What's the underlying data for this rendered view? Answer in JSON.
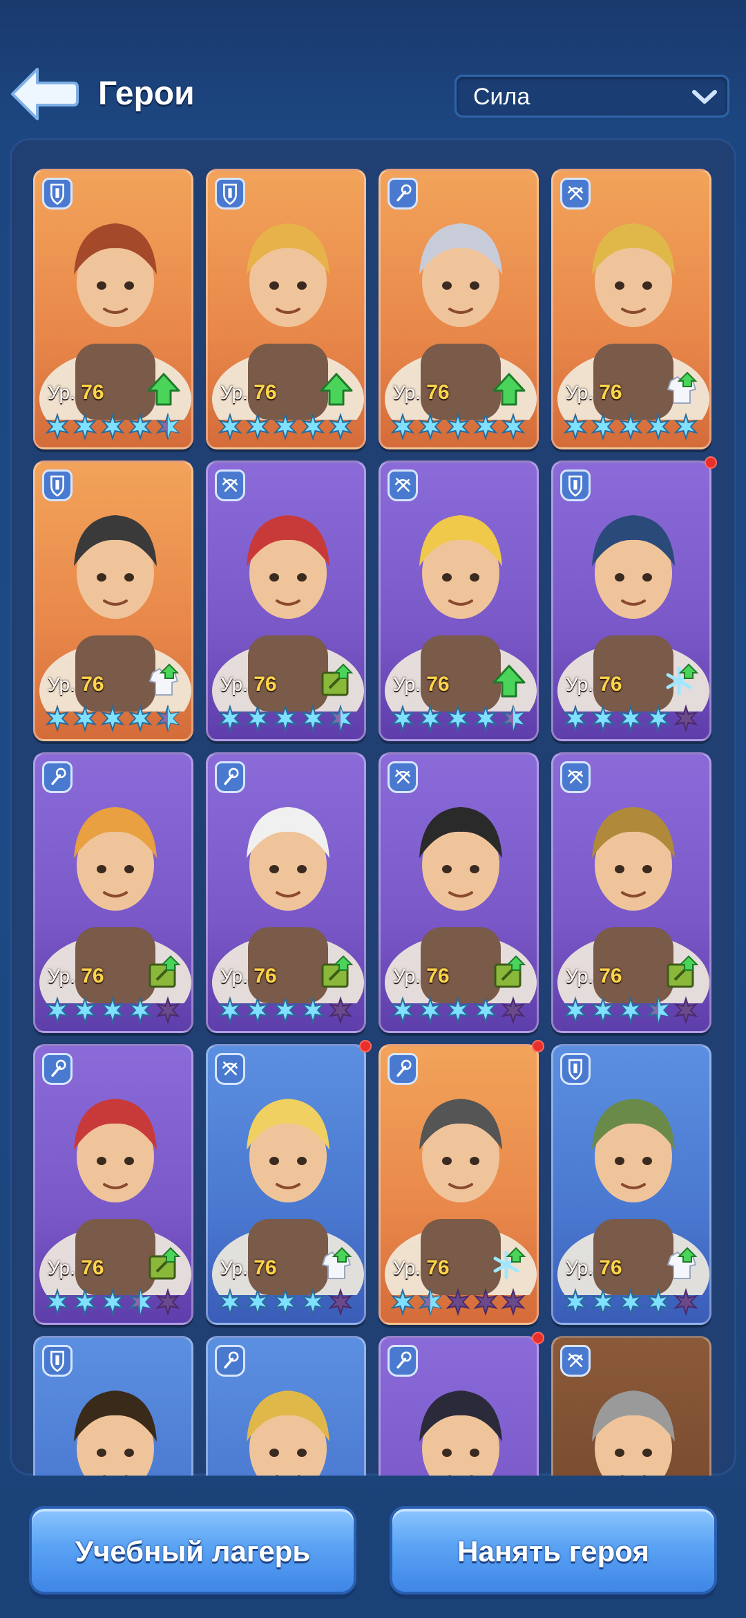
{
  "header": {
    "title": "Герои",
    "sort": {
      "selected": "Сила"
    }
  },
  "cards": [
    {
      "bg": "orange",
      "role": "shield",
      "level_prefix": "Ур.",
      "level": "76",
      "upgrade": "arrow",
      "stars": 4.5,
      "dot": false,
      "hair": "#a44a2a"
    },
    {
      "bg": "orange",
      "role": "shield",
      "level_prefix": "Ур.",
      "level": "76",
      "upgrade": "arrow",
      "stars": 5,
      "dot": false,
      "hair": "#e8b24a"
    },
    {
      "bg": "orange",
      "role": "wrench",
      "level_prefix": "Ур.",
      "level": "76",
      "upgrade": "arrow",
      "stars": 5,
      "dot": false,
      "hair": "#c8ccd8"
    },
    {
      "bg": "orange",
      "role": "crossbow",
      "level_prefix": "Ур.",
      "level": "76",
      "upgrade": "coat",
      "stars": 5,
      "dot": false,
      "hair": "#e0b84a"
    },
    {
      "bg": "orange",
      "role": "shield",
      "level_prefix": "Ур.",
      "level": "76",
      "upgrade": "coat",
      "stars": 4.5,
      "dot": false,
      "hair": "#3a3a3a"
    },
    {
      "bg": "purple",
      "role": "crossbow",
      "level_prefix": "Ур.",
      "level": "76",
      "upgrade": "book",
      "stars": 4.5,
      "dot": false,
      "hair": "#c83a3a"
    },
    {
      "bg": "purple",
      "role": "crossbow",
      "level_prefix": "Ур.",
      "level": "76",
      "upgrade": "arrow",
      "stars": 4.5,
      "dot": false,
      "hair": "#f0c84a"
    },
    {
      "bg": "purple",
      "role": "shield",
      "level_prefix": "Ур.",
      "level": "76",
      "upgrade": "snowflake",
      "stars": 4,
      "dot": true,
      "hair": "#2a4a7a"
    },
    {
      "bg": "purple",
      "role": "wrench",
      "level_prefix": "Ур.",
      "level": "76",
      "upgrade": "book",
      "stars": 4,
      "dot": false,
      "hair": "#e8a040"
    },
    {
      "bg": "purple",
      "role": "wrench",
      "level_prefix": "Ур.",
      "level": "76",
      "upgrade": "book",
      "stars": 4,
      "dot": false,
      "hair": "#f0f0f0"
    },
    {
      "bg": "purple",
      "role": "crossbow",
      "level_prefix": "Ур.",
      "level": "76",
      "upgrade": "book",
      "stars": 4,
      "dot": false,
      "hair": "#2a2a2a"
    },
    {
      "bg": "purple",
      "role": "crossbow",
      "level_prefix": "Ур.",
      "level": "76",
      "upgrade": "book",
      "stars": 3.5,
      "dot": false,
      "hair": "#b08a3a"
    },
    {
      "bg": "purple",
      "role": "wrench",
      "level_prefix": "Ур.",
      "level": "76",
      "upgrade": "book",
      "stars": 3.5,
      "dot": false,
      "hair": "#c83a3a"
    },
    {
      "bg": "blue",
      "role": "crossbow",
      "level_prefix": "Ур.",
      "level": "76",
      "upgrade": "coat",
      "stars": 4,
      "dot": true,
      "hair": "#f0d060"
    },
    {
      "bg": "orange",
      "role": "wrench",
      "level_prefix": "Ур.",
      "level": "76",
      "upgrade": "snowflake",
      "stars": 1.5,
      "dot": true,
      "hair": "#555555"
    },
    {
      "bg": "blue",
      "role": "shield",
      "level_prefix": "Ур.",
      "level": "76",
      "upgrade": "coat",
      "stars": 4,
      "dot": false,
      "hair": "#6a8a4a"
    },
    {
      "bg": "blue",
      "role": "shield",
      "level_prefix": "",
      "level": "",
      "upgrade": "",
      "stars": 0,
      "dot": false,
      "hair": "#3a2a1a"
    },
    {
      "bg": "blue",
      "role": "wrench",
      "level_prefix": "",
      "level": "",
      "upgrade": "",
      "stars": 0,
      "dot": false,
      "hair": "#e0b84a"
    },
    {
      "bg": "purple",
      "role": "wrench",
      "level_prefix": "",
      "level": "",
      "upgrade": "",
      "stars": 0,
      "dot": true,
      "hair": "#2a2a3a"
    },
    {
      "bg": "brown",
      "role": "crossbow",
      "level_prefix": "",
      "level": "",
      "upgrade": "",
      "stars": 0,
      "dot": false,
      "hair": "#9a9a9a"
    }
  ],
  "buttons": {
    "training": "Учебный лагерь",
    "hire": "Нанять героя"
  }
}
